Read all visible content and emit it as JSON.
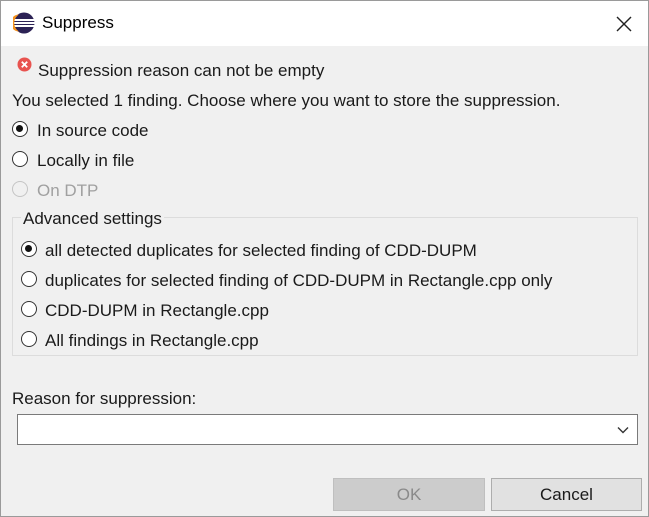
{
  "window": {
    "title": "Suppress"
  },
  "error": {
    "message": "Suppression reason can not be empty"
  },
  "intro": "You selected 1 finding. Choose where you want to store the suppression.",
  "storage_options": [
    {
      "label": "In source code",
      "checked": true,
      "enabled": true
    },
    {
      "label": "Locally in file",
      "checked": false,
      "enabled": true
    },
    {
      "label": "On DTP",
      "checked": false,
      "enabled": false
    }
  ],
  "advanced": {
    "title": "Advanced settings",
    "options": [
      {
        "label": "all detected duplicates for selected finding of CDD-DUPM",
        "checked": true
      },
      {
        "label": "duplicates for selected finding of CDD-DUPM in Rectangle.cpp only",
        "checked": false
      },
      {
        "label": "CDD-DUPM in Rectangle.cpp",
        "checked": false
      },
      {
        "label": "All findings in Rectangle.cpp",
        "checked": false
      }
    ]
  },
  "reason": {
    "label": "Reason for suppression:",
    "value": ""
  },
  "buttons": {
    "ok": "OK",
    "cancel": "Cancel",
    "ok_enabled": false
  }
}
